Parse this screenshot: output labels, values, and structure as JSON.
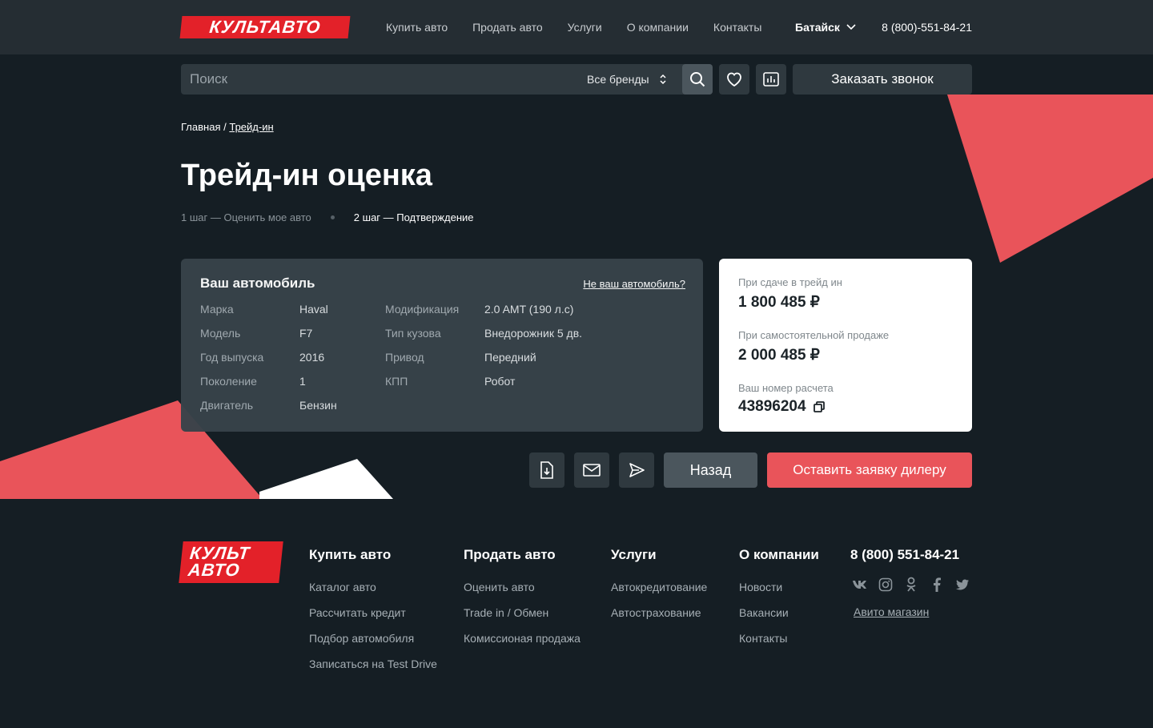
{
  "header": {
    "logo": "КУЛЬТАВТО",
    "nav": [
      "Купить авто",
      "Продать авто",
      "Услуги",
      "О компании",
      "Контакты"
    ],
    "city": "Батайск",
    "phone": "8 (800)-551-84-21"
  },
  "search": {
    "placeholder": "Поиск",
    "brands_select": "Все бренды",
    "callback_label": "Заказать звонок"
  },
  "breadcrumb": {
    "home": "Главная",
    "separator": "/",
    "current": "Трейд-ин"
  },
  "page": {
    "title": "Трейд-ин оценка",
    "step1": "1 шаг — Оценить мое авто",
    "step2": "2 шаг — Подтверждение"
  },
  "car": {
    "heading": "Ваш автомобиль",
    "not_yours": "Не ваш автомобиль?",
    "left_specs": [
      {
        "k": "Марка",
        "v": "Haval"
      },
      {
        "k": "Модель",
        "v": "F7"
      },
      {
        "k": "Год выпуска",
        "v": "2016"
      },
      {
        "k": "Поколение",
        "v": "1"
      },
      {
        "k": "Двигатель",
        "v": "Бензин"
      }
    ],
    "right_specs": [
      {
        "k": "Модификация",
        "v": "2.0 AMT (190 л.с)"
      },
      {
        "k": "Тип кузова",
        "v": "Внедорожник 5 дв."
      },
      {
        "k": "Привод",
        "v": "Передний"
      },
      {
        "k": "КПП",
        "v": "Робот"
      }
    ]
  },
  "prices": {
    "tradein_label": "При сдаче в трейд ин",
    "tradein_value": "1 800 485 ₽",
    "self_label": "При самостоятельной продаже",
    "self_value": "2 000 485 ₽",
    "calc_label": "Ваш номер расчета",
    "calc_value": "43896204"
  },
  "actions": {
    "back": "Назад",
    "dealer": "Оставить заявку дилеру"
  },
  "footer": {
    "logo_line1": "КУЛЬТ",
    "logo_line2": "АВТО",
    "col_buy": {
      "title": "Купить авто",
      "links": [
        "Каталог авто",
        "Рассчитать кредит",
        "Подбор автомобиля",
        "Записаться на Test Drive"
      ]
    },
    "col_sell": {
      "title": "Продать авто",
      "links": [
        "Оценить авто",
        "Trade in / Обмен",
        "Комиссионая продажа"
      ]
    },
    "col_services": {
      "title": "Услуги",
      "links": [
        "Автокредитование",
        "Автострахование"
      ]
    },
    "col_company": {
      "title": "О компании",
      "links": [
        "Новости",
        "Вакансии",
        "Контакты"
      ]
    },
    "phone": "8 (800) 551-84-21",
    "avito": "Авито магазин"
  },
  "colors": {
    "accent": "#e9545a",
    "logo_red": "#e32129",
    "bg": "#151e24",
    "topbar": "#252d33"
  }
}
